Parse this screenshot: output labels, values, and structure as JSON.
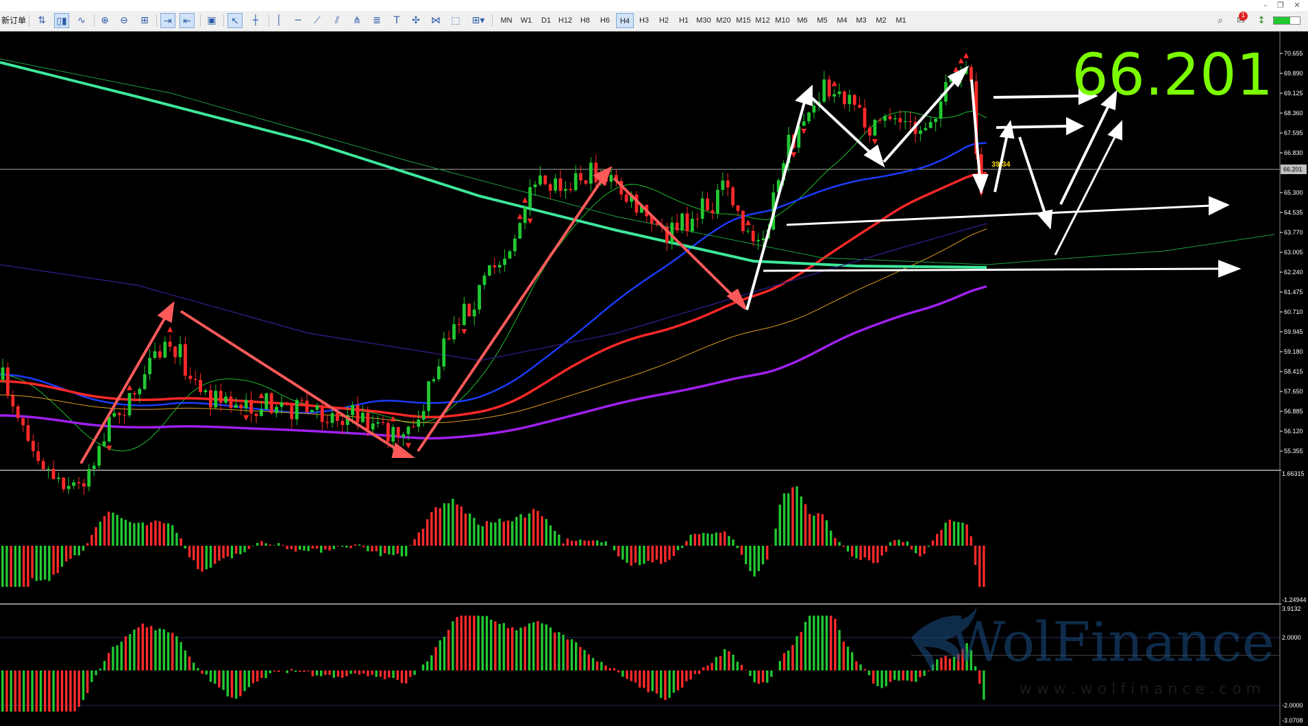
{
  "toolbar": {
    "new_order": "新订单",
    "icons": [
      "chart-type-icon",
      "candlesticks-icon",
      "line-chart-icon",
      "zoom-in-icon",
      "zoom-out-icon",
      "tile-windows-icon",
      "autoscroll-icon",
      "chart-shift-icon",
      "screenshot-icon",
      "cursor-icon",
      "crosshair-icon",
      "vertical-line-icon",
      "horizontal-line-icon",
      "trend-line-icon",
      "channel-icon",
      "pitchfork-icon",
      "fibonacci-icon",
      "text-icon",
      "arrows-icon",
      "gann-icon",
      "shapes-icon",
      "more-objects-icon"
    ],
    "timeframes": [
      "MN",
      "W1",
      "D1",
      "H12",
      "H8",
      "H6",
      "H4",
      "H3",
      "H2",
      "H1",
      "M30",
      "M20",
      "M15",
      "M12",
      "M10",
      "M6",
      "M5",
      "M4",
      "M3",
      "M2",
      "M1"
    ],
    "active_timeframe": "H4",
    "notification_count": "1"
  },
  "window_controls": [
    "minimize-icon",
    "restore-icon",
    "close-icon"
  ],
  "price_axis_labels": [
    "70.655",
    "69.890",
    "69.125",
    "68.360",
    "67.595",
    "66.830",
    "66.201",
    "65.300",
    "64.535",
    "63.770",
    "63.005",
    "62.240",
    "61.475",
    "60.710",
    "59.945",
    "59.180",
    "58.415",
    "57.650",
    "56.885",
    "56.120",
    "55.355"
  ],
  "current_price": "66.201",
  "big_price_annotation": "66.201",
  "small_yellow_label": "39.34",
  "macd_axis": {
    "top": "1.66315",
    "bottom": "-1.24944"
  },
  "osc_axis": {
    "top": "3.9132",
    "mid_high": "2.0000",
    "mid_low": "-2.0000",
    "bottom": "-3.0708"
  },
  "watermark": {
    "brand": "WolFinance",
    "url": "w w w . w o l f i n a n c e . c o m"
  },
  "colors": {
    "bull_candle": "#22c832",
    "bear_candle": "#ff2a2a",
    "ma_fast_red": "#ff2828",
    "ma_blue": "#1b3cff",
    "ma_purple": "#a020f0",
    "ma_slow_green": "#3de89a",
    "big_label": "#7cfc00",
    "annotation_white": "#ffffff",
    "annotation_pink": "#ff5a5a"
  }
}
